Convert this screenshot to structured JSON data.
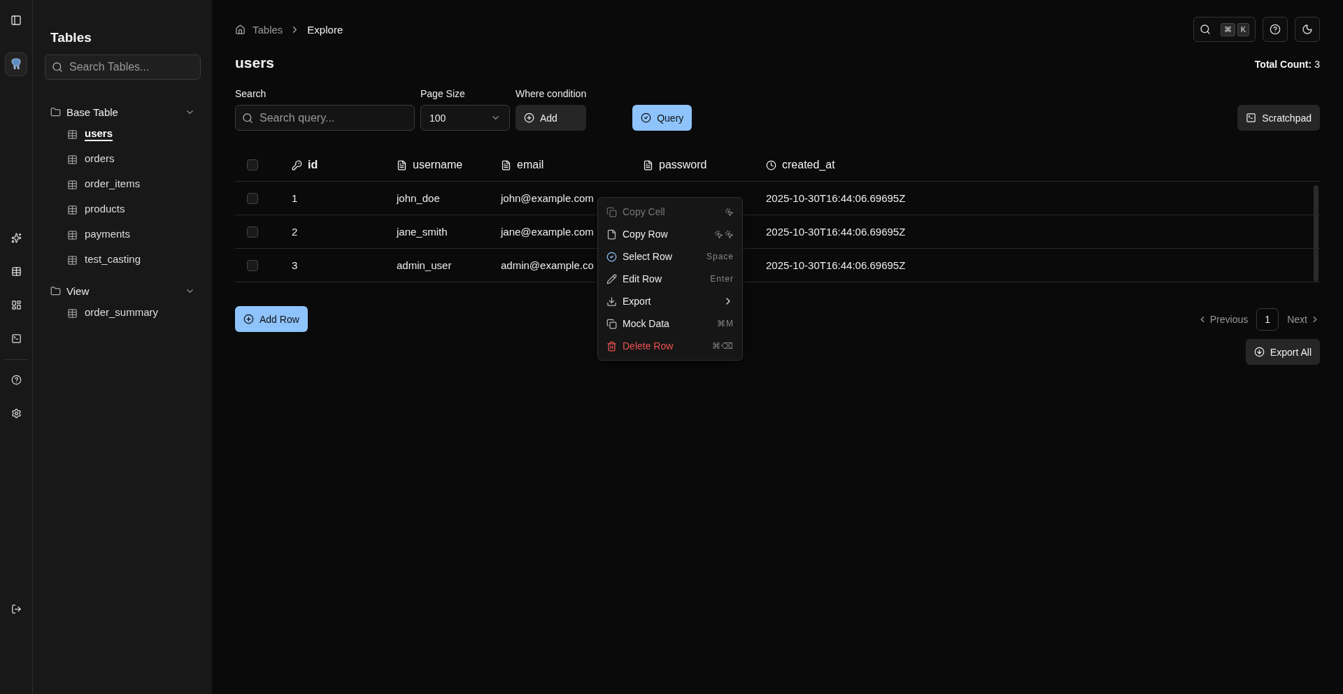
{
  "sidebar": {
    "title": "Tables",
    "search": {
      "placeholder": "Search Tables..."
    },
    "groups": [
      {
        "label": "Base Table",
        "expanded": true,
        "children": [
          {
            "label": "users",
            "selected": true
          },
          {
            "label": "orders",
            "selected": false
          },
          {
            "label": "order_items",
            "selected": false
          },
          {
            "label": "products",
            "selected": false
          },
          {
            "label": "payments",
            "selected": false
          },
          {
            "label": "test_casting",
            "selected": false
          }
        ]
      },
      {
        "label": "View",
        "expanded": true,
        "children": [
          {
            "label": "order_summary",
            "selected": false
          }
        ]
      }
    ]
  },
  "breadcrumb": [
    "Tables",
    "Explore"
  ],
  "command_keys": [
    "⌘",
    "K"
  ],
  "page_title": "users",
  "total_count": {
    "label": "Total Count:",
    "value": "3"
  },
  "filters": {
    "search": {
      "label": "Search",
      "placeholder": "Search query..."
    },
    "page_size": {
      "label": "Page Size",
      "value": "100"
    },
    "where": {
      "label": "Where condition",
      "button": "Add"
    },
    "query_button": "Query",
    "scratchpad_button": "Scratchpad"
  },
  "table": {
    "all_checked": false,
    "columns": [
      {
        "label": "id",
        "kind": "key"
      },
      {
        "label": "username",
        "kind": "text"
      },
      {
        "label": "email",
        "kind": "text"
      },
      {
        "label": "password",
        "kind": "text"
      },
      {
        "label": "created_at",
        "kind": "time"
      }
    ],
    "rows": [
      {
        "checked": false,
        "cells": [
          "1",
          "john_doe",
          "john@example.com",
          "",
          "2025-10-30T16:44:06.69695Z"
        ]
      },
      {
        "checked": false,
        "cells": [
          "2",
          "jane_smith",
          "jane@example.com",
          "",
          "2025-10-30T16:44:06.69695Z"
        ]
      },
      {
        "checked": false,
        "cells": [
          "3",
          "admin_user",
          "admin@example.co",
          "",
          "2025-10-30T16:44:06.69695Z"
        ]
      }
    ]
  },
  "add_row_button": "Add Row",
  "pagination": {
    "previous": "Previous",
    "pages": [
      {
        "label": "1",
        "selected": true
      }
    ],
    "next": "Next"
  },
  "export_all_button": "Export All",
  "context_menu": [
    {
      "label": "Copy Cell",
      "kind": "disabled"
    },
    {
      "label": "Copy Row",
      "kind": "normal"
    },
    {
      "label": "Select Row",
      "kind": "normal",
      "shortcut": "Space"
    },
    {
      "label": "Edit Row",
      "kind": "normal",
      "shortcut": "Enter"
    },
    {
      "label": "Export",
      "kind": "normal"
    },
    {
      "label": "Mock Data",
      "kind": "normal",
      "shortcut": "⌘M"
    },
    {
      "label": "Delete Row",
      "kind": "danger",
      "shortcut": "⌘⌫"
    }
  ]
}
